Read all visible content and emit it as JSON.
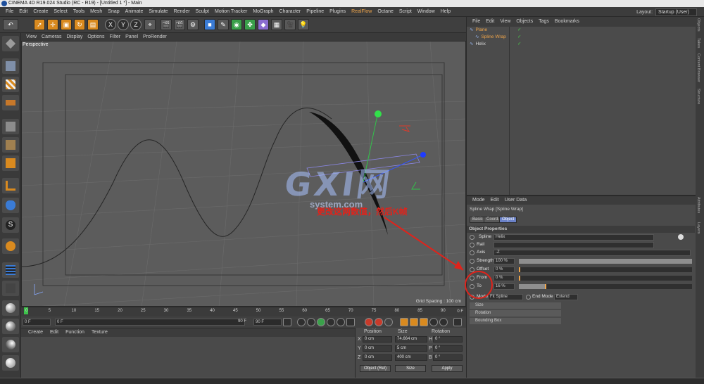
{
  "window": {
    "title": "CINEMA 4D R19.024 Studio (RC - R19) - [Untitled 1 *] - Main"
  },
  "menubar": {
    "items": [
      "File",
      "Edit",
      "Create",
      "Select",
      "Tools",
      "Mesh",
      "Snap",
      "Animate",
      "Simulate",
      "Render",
      "Sculpt",
      "Motion Tracker",
      "MoGraph",
      "Character",
      "Pipeline",
      "Plugins",
      "RealFlow",
      "Octane",
      "Script",
      "Window",
      "Help"
    ],
    "highlight": "RealFlow",
    "layout_label": "Layout:",
    "layout_value": "Startup (User)"
  },
  "viewport": {
    "menu": [
      "View",
      "Cameras",
      "Display",
      "Options",
      "Filter",
      "Panel",
      "ProRender"
    ],
    "label": "Perspective",
    "grid_spacing": "Grid Spacing : 100 cm"
  },
  "timeline": {
    "ticks": [
      "0",
      "5",
      "10",
      "15",
      "20",
      "25",
      "30",
      "35",
      "40",
      "45",
      "50",
      "55",
      "60",
      "65",
      "70",
      "75",
      "80",
      "85",
      "90"
    ],
    "end_label": "0 F",
    "current_frame": "0 F",
    "start_field": "0 F",
    "end_field": "90 F",
    "end_field2": "90 F",
    "playhead_value": 0
  },
  "materials": {
    "menu": [
      "Create",
      "Edit",
      "Function",
      "Texture"
    ]
  },
  "coords": {
    "headers": [
      "Position",
      "Size",
      "Rotation"
    ],
    "rows": [
      {
        "axis": "X",
        "pos": "0 cm",
        "size": "74.664 cm",
        "rot_axis": "H",
        "rot": "0 °"
      },
      {
        "axis": "Y",
        "pos": "0 cm",
        "size": "5 cm",
        "rot_axis": "P",
        "rot": "0 °"
      },
      {
        "axis": "Z",
        "pos": "0 cm",
        "size": "400 cm",
        "rot_axis": "B",
        "rot": "0 °"
      }
    ],
    "mode": "Object (Rel)",
    "size_mode": "Size",
    "apply": "Apply"
  },
  "objects": {
    "menu": [
      "File",
      "Edit",
      "View",
      "Objects",
      "Tags",
      "Bookmarks"
    ],
    "items": [
      {
        "name": "Plane",
        "color": "#f0a54a",
        "indent": 0
      },
      {
        "name": "Spline Wrap",
        "color": "#f0a54a",
        "indent": 1
      },
      {
        "name": "Helix",
        "color": "#d8d8d8",
        "indent": 0
      }
    ]
  },
  "attributes": {
    "menu": [
      "Mode",
      "Edit",
      "User Data"
    ],
    "object_title": "Spline Wrap [Spline Wrap]",
    "tabs": [
      {
        "label": "Basic",
        "active": false
      },
      {
        "label": "Coord.",
        "active": false
      },
      {
        "label": "Object",
        "active": true
      }
    ],
    "section": "Object Properties",
    "spline": {
      "label": "Spline",
      "value": "Helix"
    },
    "rail": {
      "label": "Rail"
    },
    "axis": {
      "label": "Axis",
      "value": "-Z"
    },
    "strength": {
      "label": "Strength",
      "value": "100 %",
      "fraction": 1.0
    },
    "offset": {
      "label": "Offset",
      "value": "0 %",
      "fraction": 0.0
    },
    "from": {
      "label": "From",
      "value": "0 %",
      "fraction": 0.0
    },
    "to": {
      "label": "To",
      "value": "16 %",
      "fraction": 0.16
    },
    "mode": {
      "label": "Mode",
      "value": "Fit Spline"
    },
    "end_mode": {
      "label": "End Mode",
      "value": "Extend"
    },
    "groups": [
      "Size",
      "Rotation",
      "Bounding Box"
    ]
  },
  "right_tabs": [
    "Objects",
    "Takes",
    "Content Browser",
    "Structure",
    "Attributes",
    "Layers"
  ],
  "overlay": {
    "watermark": "GXI网",
    "watermark_sub": "system.com",
    "annotation": "更改这两数值，然后K帧"
  },
  "colors": {
    "accent": "#f0a54a",
    "annotation": "#e0231b",
    "tab_active": "#6b82c8"
  }
}
